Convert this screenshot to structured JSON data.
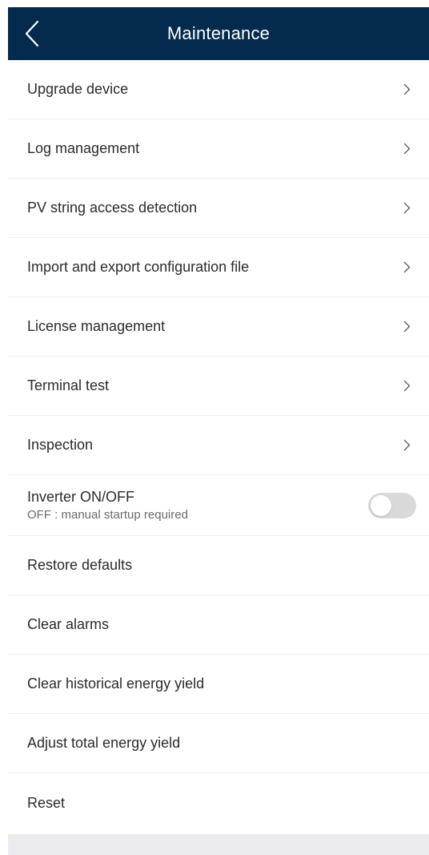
{
  "header": {
    "title": "Maintenance",
    "back_icon": "chevron-left-icon"
  },
  "menu": {
    "nav_items": [
      {
        "label": "Upgrade device"
      },
      {
        "label": "Log management"
      },
      {
        "label": "PV string access detection"
      },
      {
        "label": "Import and export configuration file"
      },
      {
        "label": "License management"
      },
      {
        "label": "Terminal test"
      },
      {
        "label": "Inspection"
      }
    ],
    "inverter": {
      "label": "Inverter ON/OFF",
      "status": "OFF : manual startup required",
      "enabled": false
    },
    "actions": [
      {
        "label": "Restore defaults"
      },
      {
        "label": "Clear alarms"
      },
      {
        "label": "Clear historical energy yield"
      },
      {
        "label": "Adjust total energy yield"
      },
      {
        "label": "Reset"
      }
    ]
  },
  "colors": {
    "header_bg": "#042a4d",
    "divider": "#efefef",
    "toggle_off": "#d9d9d9",
    "bottom_band": "#ebebef"
  }
}
